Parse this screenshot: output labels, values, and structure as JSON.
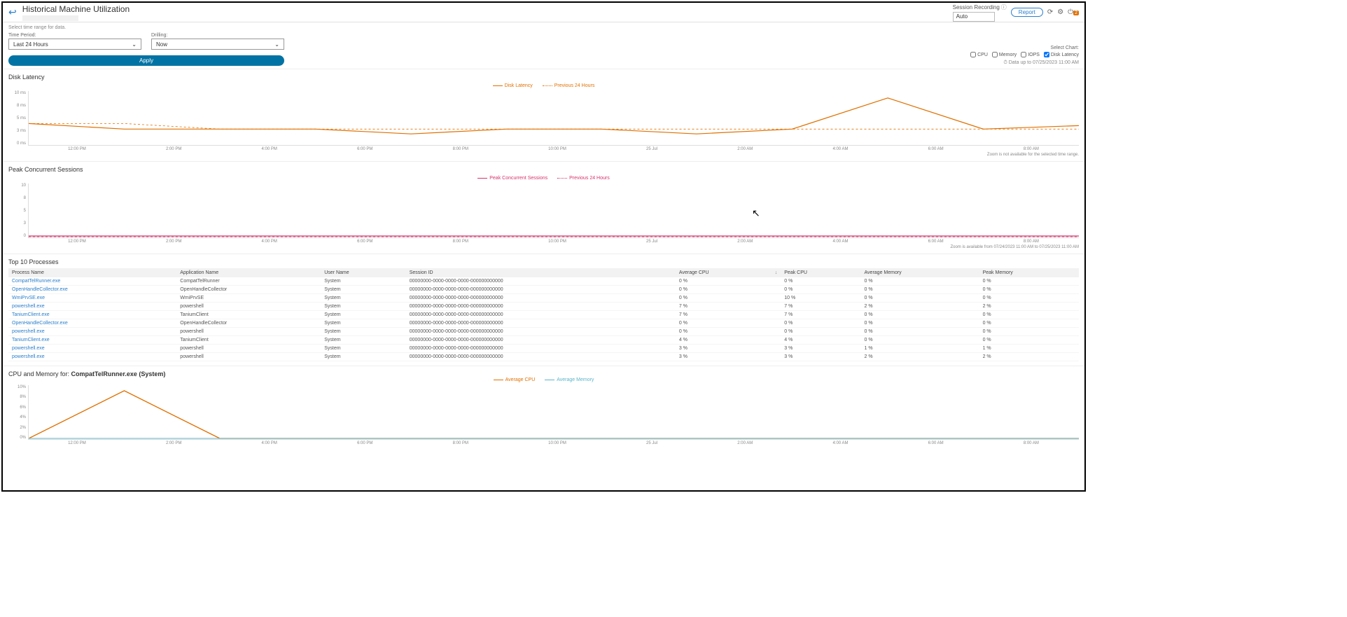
{
  "header": {
    "title": "Historical Machine Utilization",
    "session_recording_label": "Session Recording",
    "session_recording_value": "Auto",
    "report_button": "Report"
  },
  "controls": {
    "hint": "Select time range for data.",
    "time_period_label": "Time Period:",
    "time_period_value": "Last 24 Hours",
    "drilling_label": "Drilling:",
    "drilling_value": "Now",
    "apply": "Apply",
    "select_chart_label": "Select Chart:",
    "checks": [
      {
        "label": "CPU",
        "checked": false
      },
      {
        "label": "Memory",
        "checked": false
      },
      {
        "label": "IOPS",
        "checked": false
      },
      {
        "label": "Disk Latency",
        "checked": true
      }
    ],
    "data_time": "Data up to 07/25/2023 11:00 AM"
  },
  "disk_latency": {
    "title": "Disk Latency",
    "legend_current": "Disk Latency",
    "legend_prev": "Previous 24 Hours",
    "zoom_note": "Zoom is not available for the selected time range."
  },
  "sessions": {
    "title": "Peak Concurrent Sessions",
    "legend_current": "Peak Concurrent Sessions",
    "legend_prev": "Previous 24 Hours",
    "zoom_note": "Zoom is available from 07/24/2023 11:00 AM to 07/25/2023 11:00 AM"
  },
  "processes": {
    "title": "Top 10 Processes",
    "columns": [
      "Process Name",
      "Application Name",
      "User Name",
      "Session ID",
      "Average CPU",
      "Peak CPU",
      "Average Memory",
      "Peak Memory"
    ]
  },
  "process_rows": [
    {
      "pn": "CompatTelRunner.exe",
      "an": "CompatTelRunner",
      "un": "System",
      "sid": "00000000-0000-0000-0000-000000000000",
      "acpu": "0 %",
      "pcpu": "0 %",
      "amem": "0 %",
      "pmem": "0 %"
    },
    {
      "pn": "OpenHandleCollector.exe",
      "an": "OpenHandleCollector",
      "un": "System",
      "sid": "00000000-0000-0000-0000-000000000000",
      "acpu": "0 %",
      "pcpu": "0 %",
      "amem": "0 %",
      "pmem": "0 %"
    },
    {
      "pn": "WmiPrvSE.exe",
      "an": "WmiPrvSE",
      "un": "System",
      "sid": "00000000-0000-0000-0000-000000000000",
      "acpu": "0 %",
      "pcpu": "10 %",
      "amem": "0 %",
      "pmem": "0 %"
    },
    {
      "pn": "powershell.exe",
      "an": "powershell",
      "un": "System",
      "sid": "00000000-0000-0000-0000-000000000000",
      "acpu": "7 %",
      "pcpu": "7 %",
      "amem": "2 %",
      "pmem": "2 %"
    },
    {
      "pn": "TaniumClient.exe",
      "an": "TaniumClient",
      "un": "System",
      "sid": "00000000-0000-0000-0000-000000000000",
      "acpu": "7 %",
      "pcpu": "7 %",
      "amem": "0 %",
      "pmem": "0 %"
    },
    {
      "pn": "OpenHandleCollector.exe",
      "an": "OpenHandleCollector",
      "un": "System",
      "sid": "00000000-0000-0000-0000-000000000000",
      "acpu": "0 %",
      "pcpu": "0 %",
      "amem": "0 %",
      "pmem": "0 %"
    },
    {
      "pn": "powershell.exe",
      "an": "powershell",
      "un": "System",
      "sid": "00000000-0000-0000-0000-000000000000",
      "acpu": "0 %",
      "pcpu": "0 %",
      "amem": "0 %",
      "pmem": "0 %"
    },
    {
      "pn": "TaniumClient.exe",
      "an": "TaniumClient",
      "un": "System",
      "sid": "00000000-0000-0000-0000-000000000000",
      "acpu": "4 %",
      "pcpu": "4 %",
      "amem": "0 %",
      "pmem": "0 %"
    },
    {
      "pn": "powershell.exe",
      "an": "powershell",
      "un": "System",
      "sid": "00000000-0000-0000-0000-000000000000",
      "acpu": "3 %",
      "pcpu": "3 %",
      "amem": "1 %",
      "pmem": "1 %"
    },
    {
      "pn": "powershell.exe",
      "an": "powershell",
      "un": "System",
      "sid": "00000000-0000-0000-0000-000000000000",
      "acpu": "3 %",
      "pcpu": "3 %",
      "amem": "2 %",
      "pmem": "2 %"
    }
  ],
  "cpumem": {
    "title_prefix": "CPU and Memory for: ",
    "title_target": "CompatTelRunner.exe (System)",
    "legend_cpu": "Average CPU",
    "legend_mem": "Average Memory"
  },
  "xaxis_main": [
    "12:00 PM",
    "2:00 PM",
    "4:00 PM",
    "6:00 PM",
    "8:00 PM",
    "10:00 PM",
    "25 Jul",
    "2:00 AM",
    "4:00 AM",
    "6:00 AM",
    "8:00 AM"
  ],
  "yaxis_latency": [
    "10 ms",
    "8 ms",
    "5 ms",
    "3 ms",
    "0 ms"
  ],
  "yaxis_sessions": [
    "10",
    "8",
    "5",
    "3",
    "0"
  ],
  "yaxis_cpumem": [
    "10%",
    "8%",
    "6%",
    "4%",
    "2%",
    "0%"
  ],
  "chart_data": [
    {
      "type": "line",
      "title": "Disk Latency",
      "ylabel": "ms",
      "ylim": [
        0,
        10
      ],
      "categories": [
        "12:00 PM",
        "2:00 PM",
        "4:00 PM",
        "6:00 PM",
        "8:00 PM",
        "10:00 PM",
        "25 Jul",
        "2:00 AM",
        "4:00 AM",
        "6:00 AM",
        "8:00 AM"
      ],
      "series": [
        {
          "name": "Disk Latency",
          "values": [
            4,
            3,
            3,
            3,
            2,
            3,
            3,
            2,
            3,
            9,
            3
          ]
        },
        {
          "name": "Previous 24 Hours",
          "values": [
            4,
            4,
            3,
            3,
            3,
            3,
            3,
            3,
            3,
            3,
            3
          ]
        }
      ]
    },
    {
      "type": "line",
      "title": "Peak Concurrent Sessions",
      "ylabel": "",
      "ylim": [
        0,
        10
      ],
      "categories": [
        "12:00 PM",
        "2:00 PM",
        "4:00 PM",
        "6:00 PM",
        "8:00 PM",
        "10:00 PM",
        "25 Jul",
        "2:00 AM",
        "4:00 AM",
        "6:00 AM",
        "8:00 AM"
      ],
      "series": [
        {
          "name": "Peak Concurrent Sessions",
          "values": [
            0,
            0,
            0,
            0,
            0,
            0,
            0,
            0,
            0,
            0,
            0
          ]
        },
        {
          "name": "Previous 24 Hours",
          "values": [
            0,
            0,
            0,
            0,
            0,
            0,
            0,
            0,
            0,
            0,
            0
          ]
        }
      ]
    },
    {
      "type": "line",
      "title": "CPU and Memory for CompatTelRunner.exe (System)",
      "ylabel": "%",
      "ylim": [
        0,
        10
      ],
      "categories": [
        "12:00 PM",
        "2:00 PM",
        "4:00 PM",
        "6:00 PM",
        "8:00 PM",
        "10:00 PM",
        "25 Jul",
        "2:00 AM",
        "4:00 AM",
        "6:00 AM",
        "8:00 AM"
      ],
      "series": [
        {
          "name": "Average CPU",
          "values": [
            0,
            9,
            0,
            0,
            0,
            0,
            0,
            0,
            0,
            0,
            0
          ]
        },
        {
          "name": "Average Memory",
          "values": [
            0,
            0,
            0,
            0,
            0,
            0,
            0,
            0,
            0,
            0,
            0
          ]
        }
      ]
    }
  ]
}
